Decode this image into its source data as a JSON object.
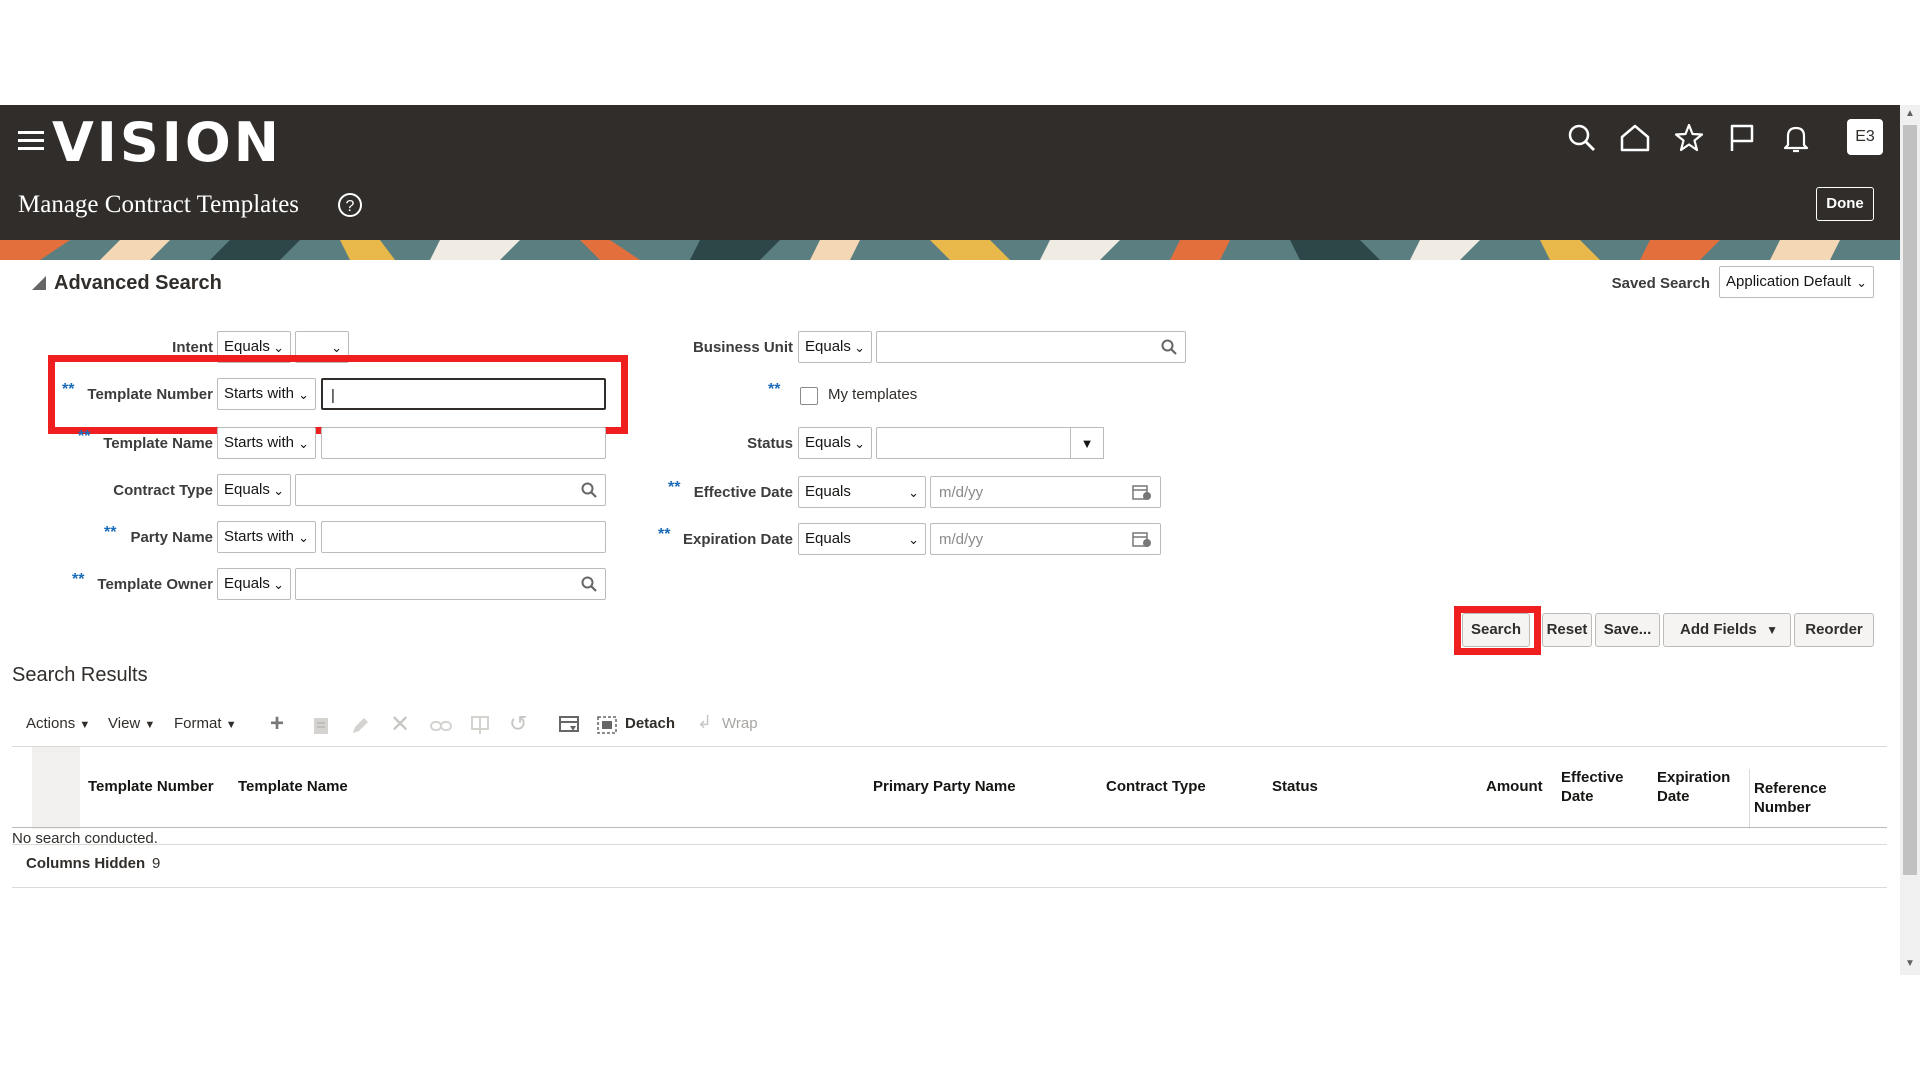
{
  "header": {
    "logo": "VISION",
    "page_title": "Manage Contract Templates",
    "avatar_initials": "E3",
    "done_label": "Done",
    "help_glyph": "?"
  },
  "search": {
    "heading": "Advanced Search",
    "saved_search_label": "Saved Search",
    "saved_search_value": "Application Default",
    "required_marker": "**",
    "fields": {
      "intent": {
        "label": "Intent",
        "operator": "Equals",
        "value": ""
      },
      "template_number": {
        "label": "Template Number",
        "operator": "Starts with",
        "value": ""
      },
      "template_name": {
        "label": "Template Name",
        "operator": "Starts with",
        "value": ""
      },
      "contract_type": {
        "label": "Contract Type",
        "operator": "Equals",
        "value": ""
      },
      "party_name": {
        "label": "Party Name",
        "operator": "Starts with",
        "value": ""
      },
      "template_owner": {
        "label": "Template Owner",
        "operator": "Equals",
        "value": ""
      },
      "business_unit": {
        "label": "Business Unit",
        "operator": "Equals",
        "value": ""
      },
      "my_templates": {
        "label": "My templates",
        "checked": false
      },
      "status": {
        "label": "Status",
        "operator": "Equals",
        "value": ""
      },
      "effective_date": {
        "label": "Effective Date",
        "operator": "Equals",
        "placeholder": "m/d/yy"
      },
      "expiration_date": {
        "label": "Expiration Date",
        "operator": "Equals",
        "placeholder": "m/d/yy"
      }
    },
    "buttons": {
      "search": "Search",
      "reset": "Reset",
      "save": "Save...",
      "add_fields": "Add Fields",
      "reorder": "Reorder"
    }
  },
  "results": {
    "heading": "Search Results",
    "toolbar": {
      "actions": "Actions",
      "view": "View",
      "format": "Format",
      "detach": "Detach",
      "wrap": "Wrap"
    },
    "columns": {
      "template_number": "Template Number",
      "template_name": "Template Name",
      "primary_party_name": "Primary Party Name",
      "contract_type": "Contract Type",
      "status": "Status",
      "amount": "Amount",
      "effective_date_1": "Effective",
      "effective_date_2": "Date",
      "expiration_date_1": "Expiration",
      "expiration_date_2": "Date",
      "reference_number_1": "Reference",
      "reference_number_2": "Number"
    },
    "empty_message": "No search conducted.",
    "columns_hidden_label": "Columns Hidden",
    "columns_hidden_count": "9"
  },
  "colors": {
    "header_bg": "#312d2a",
    "highlight": "#f01f1f",
    "required": "#1a6bb8"
  }
}
